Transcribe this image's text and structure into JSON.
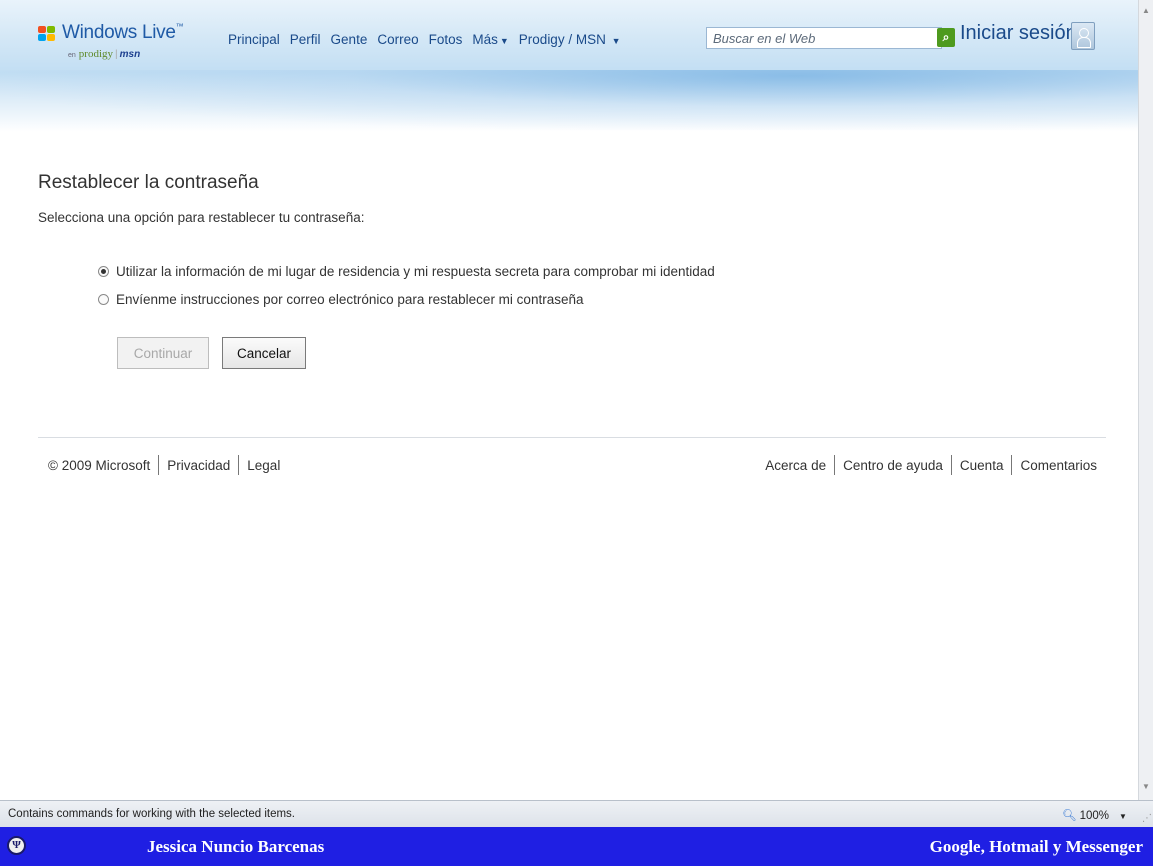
{
  "header": {
    "logo_title": "Windows Live",
    "logo_tm": "™",
    "logo_en": "en",
    "logo_prodigy": "prodigy",
    "logo_msn": "msn",
    "nav": [
      "Principal",
      "Perfil",
      "Gente",
      "Correo",
      "Fotos",
      "Más",
      "Prodigy / MSN"
    ],
    "search_placeholder": "Buscar en el Web",
    "signin": "Iniciar sesión"
  },
  "main": {
    "title": "Restablecer la contraseña",
    "instructions": "Selecciona una opción para restablecer tu contraseña:",
    "options": [
      {
        "label": "Utilizar la información de mi lugar de residencia y mi respuesta secreta para comprobar mi identidad",
        "checked": true
      },
      {
        "label": "Envíenme instrucciones por correo electrónico para restablecer mi contraseña",
        "checked": false
      }
    ],
    "continue_label": "Continuar",
    "cancel_label": "Cancelar"
  },
  "footer": {
    "copyright": "© 2009 Microsoft",
    "privacy": "Privacidad",
    "legal": "Legal",
    "about": "Acerca de",
    "help": "Centro de ayuda",
    "account": "Cuenta",
    "feedback": "Comentarios"
  },
  "statusbar": {
    "text": "Contains commands for working with the selected items.",
    "zoom": "100%"
  },
  "caption": {
    "left": "Jessica Nuncio Barcenas",
    "right": "Google, Hotmail y Messenger"
  },
  "colors": {
    "link": "#1a4a8a",
    "search_button": "#4e9a1e",
    "caption_bg": "#1f1fe3"
  }
}
